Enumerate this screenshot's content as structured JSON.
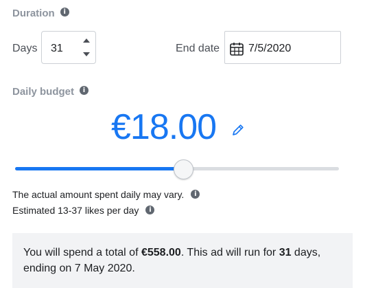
{
  "duration": {
    "label": "Duration",
    "days_label": "Days",
    "days_value": "31",
    "end_date_label": "End date",
    "end_date_value": "7/5/2020"
  },
  "budget": {
    "label": "Daily budget",
    "amount": "€18.00",
    "slider_fraction": 0.52,
    "accent_color": "#1877f2"
  },
  "notes": {
    "vary": "The actual amount spent daily may vary.",
    "likes": "Estimated 13-37 likes per day"
  },
  "summary": {
    "part1": "You will spend a total of ",
    "total": "€558.00",
    "part2": ". This ad will run for ",
    "days": "31",
    "part3": " days, ending on 7 May 2020."
  },
  "icons": {
    "info": "info-icon",
    "calendar": "calendar-icon",
    "edit": "pencil-icon"
  }
}
